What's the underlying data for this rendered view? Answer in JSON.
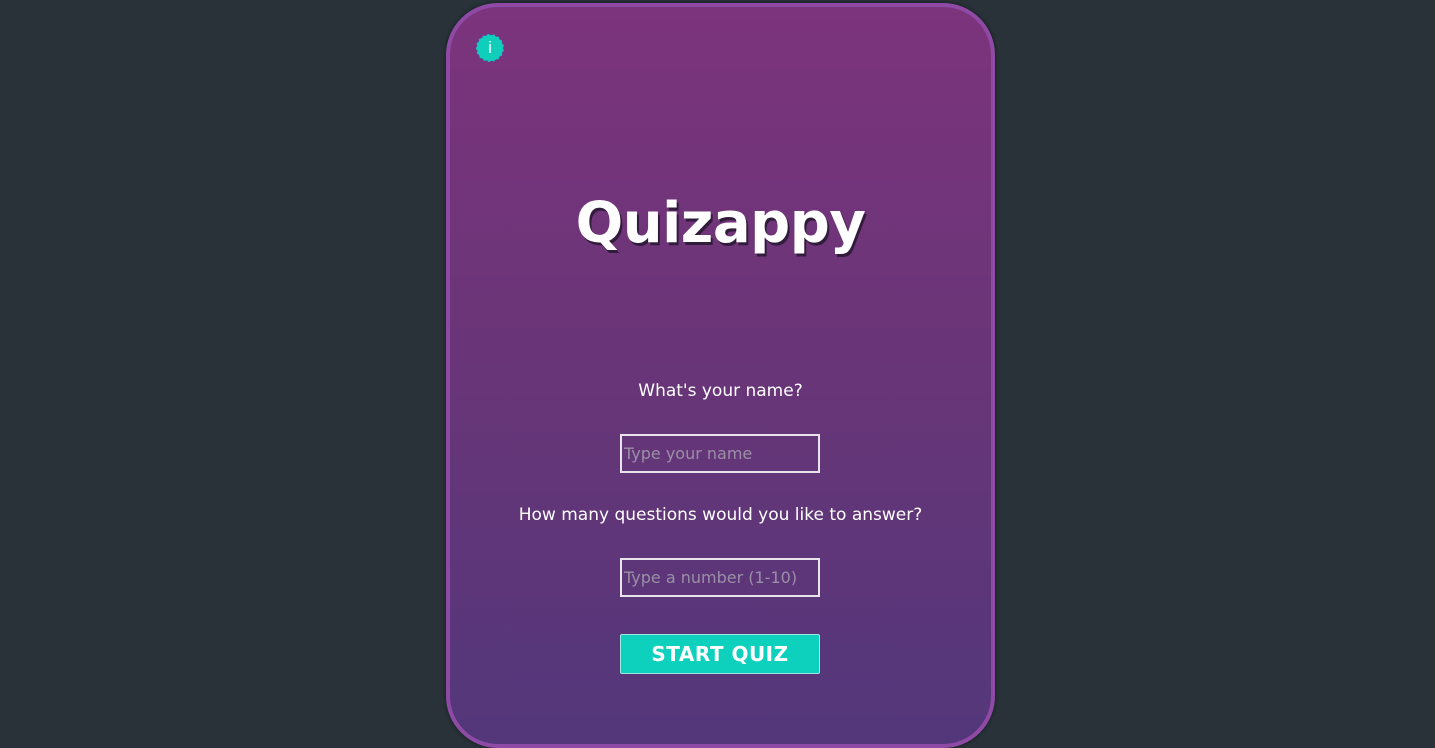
{
  "app": {
    "title": "Quizappy"
  },
  "info_button": {
    "label": "i",
    "icon": "info-icon"
  },
  "form": {
    "name_label": "What's your name?",
    "name_placeholder": "Type your name",
    "name_value": "",
    "count_label": "How many questions would you like to answer?",
    "count_placeholder": "Type a number (1-10)",
    "count_value": "",
    "start_label": "START QUIZ"
  },
  "colors": {
    "background": "#283238",
    "card_top": "#7c347c",
    "card_bottom": "#53377a",
    "card_border": "#8f4aa6",
    "accent": "#0dd0bd"
  }
}
